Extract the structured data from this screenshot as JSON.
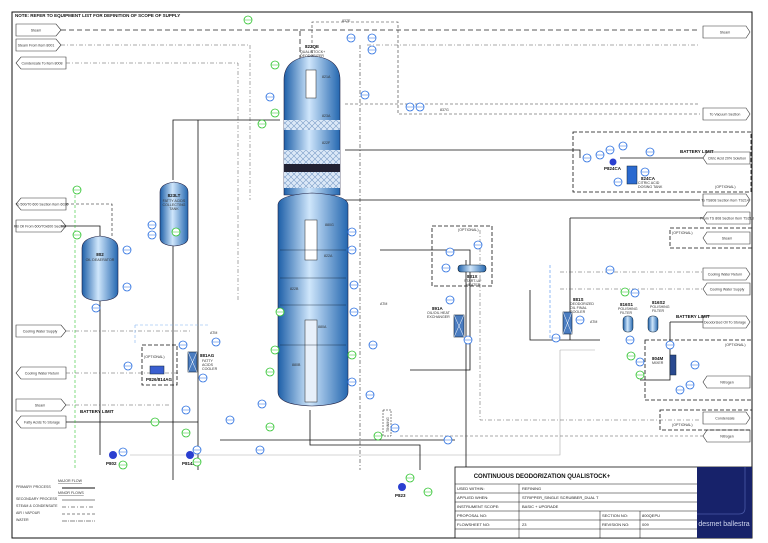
{
  "note": "NOTE: REFER TO EQUIPMENT LIST FOR DEFINITION OF SCOPE OF SUPPLY",
  "left_streams": [
    "Steam",
    "Steam From Item 8001",
    "Condensate To Item 8008",
    "To 500/70 600 Section Item 6026",
    "RB Oil From 600/70x600 Section",
    "Cooling Water Supply",
    "Cooling Water Return",
    "Steam",
    "Fatty Acids To Storage"
  ],
  "right_streams": [
    "Steam",
    "To Vacuum Section",
    "Citric Acid 20% Solution",
    "To TS808 Section Item TS214",
    "From TS 808 Section Item TS218",
    "Steam",
    "Cooling Water Return",
    "Cooling Water Supply",
    "Deodorized Oil To Storage",
    "Nitrogen",
    "Condensate",
    "Nitrogen"
  ],
  "line_labels": [
    "837E",
    "837G"
  ],
  "equipment": {
    "deodorizer": {
      "tag": "822QE",
      "name1": "QUALISTOCK+",
      "name2": "DEODORIZER"
    },
    "sections": [
      "821A",
      "823A",
      "822F",
      "880G",
      "822A",
      "822B",
      "880A",
      "880B"
    ],
    "deaerator": {
      "tag": "802",
      "name": "OIL DEAERATOR"
    },
    "fa_tank": {
      "tag": "823LT",
      "name1": "FATTY ACIDS",
      "name2": "COLLECTING",
      "name3": "TANK"
    },
    "fa_cooler": {
      "tag": "881AG",
      "name1": "FATTY",
      "name2": "ACIDS",
      "name3": "COOLER"
    },
    "fa_pump_opt": "P826/814AG",
    "startup_heater": {
      "tag": "831X",
      "name1": "START-UP",
      "name2": "HEATER"
    },
    "exchanger": {
      "tag": "891A",
      "name1": "OIL/OIL HEAT",
      "name2": "EXCHANGER"
    },
    "final_cooler": {
      "tag": "881S",
      "name1": "DEODORIZED",
      "name2": "OIL FINAL",
      "name3": "COOLER"
    },
    "filter1": {
      "tag": "816S1",
      "name1": "POLISHING",
      "name2": "FILTER"
    },
    "filter2": {
      "tag": "816S2",
      "name1": "POLISHING",
      "name2": "FILTER"
    },
    "mixer": {
      "tag": "804M",
      "name1": "MIXER"
    },
    "citric_tank": {
      "tag": "824CA",
      "name1": "CITRIC ACID",
      "name2": "DOSING TANK"
    },
    "citric_pump": "P824CA",
    "pumps": [
      "P802",
      "P814AG",
      "P823"
    ],
    "tinning": "TINNING"
  },
  "annotations": {
    "optional": "(OPTIONAL)",
    "battery_limit": "BATTERY LIMIT",
    "atm": "ATM"
  },
  "legend": {
    "major": "MAJOR FLOW",
    "primary": "PRIMARY PROCESS",
    "minor": "MINOR FLOWS",
    "secondary": "SECONDARY PROCESS",
    "steam": "STEAM & CONDENSATE",
    "air": "AIR / VAPOUR",
    "water": "WATER"
  },
  "title_block": {
    "title": "CONTINUOUS DEODORIZATION QUALISTOCK+",
    "used_within_label": "USED WITHIN:",
    "used_within": "REFINING",
    "applied_when_label": "APPLIED WHEN:",
    "applied_when": "STRIPPER_SINGLE SCRUBBER_DUAL T",
    "scope_label": "INSTRUMENT SCOPE:",
    "scope": "BASIC + UPGRADE",
    "proposal_label": "PROPOSAL NO:",
    "proposal": "",
    "section_label": "SECTION NO:",
    "section": "800QEPU",
    "flowsheet_label": "FLOWSHEET NO:",
    "flowsheet": "23",
    "revision_label": "REVISION NO:",
    "revision": "009",
    "logo": "desmet ballestra"
  },
  "colors": {
    "vessel": "#3b7fc4",
    "vessel_light": "#cfe3f6",
    "instrument": "#2a6fe0",
    "upgrade": "#2fc42f",
    "logo_bg": "#17226a",
    "line": "#111111"
  }
}
